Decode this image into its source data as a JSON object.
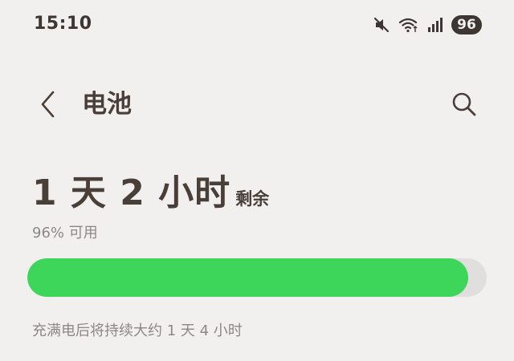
{
  "status_bar": {
    "time": "15:10",
    "battery": "96",
    "icons": [
      "mute-icon",
      "wifi-icon",
      "signal-icon"
    ]
  },
  "app_bar": {
    "title": "电池",
    "back_icon": "chevron-left-icon",
    "search_icon": "search-icon"
  },
  "battery": {
    "remaining_main": "1 天 2 小时",
    "remaining_suffix": "剩余",
    "available": "96% 可用",
    "level": 0.96,
    "fill_color": "#3dd65a",
    "track_color": "#e1dfdd",
    "full_estimate": "充满电后将持续大约 1 天 4 小时"
  }
}
